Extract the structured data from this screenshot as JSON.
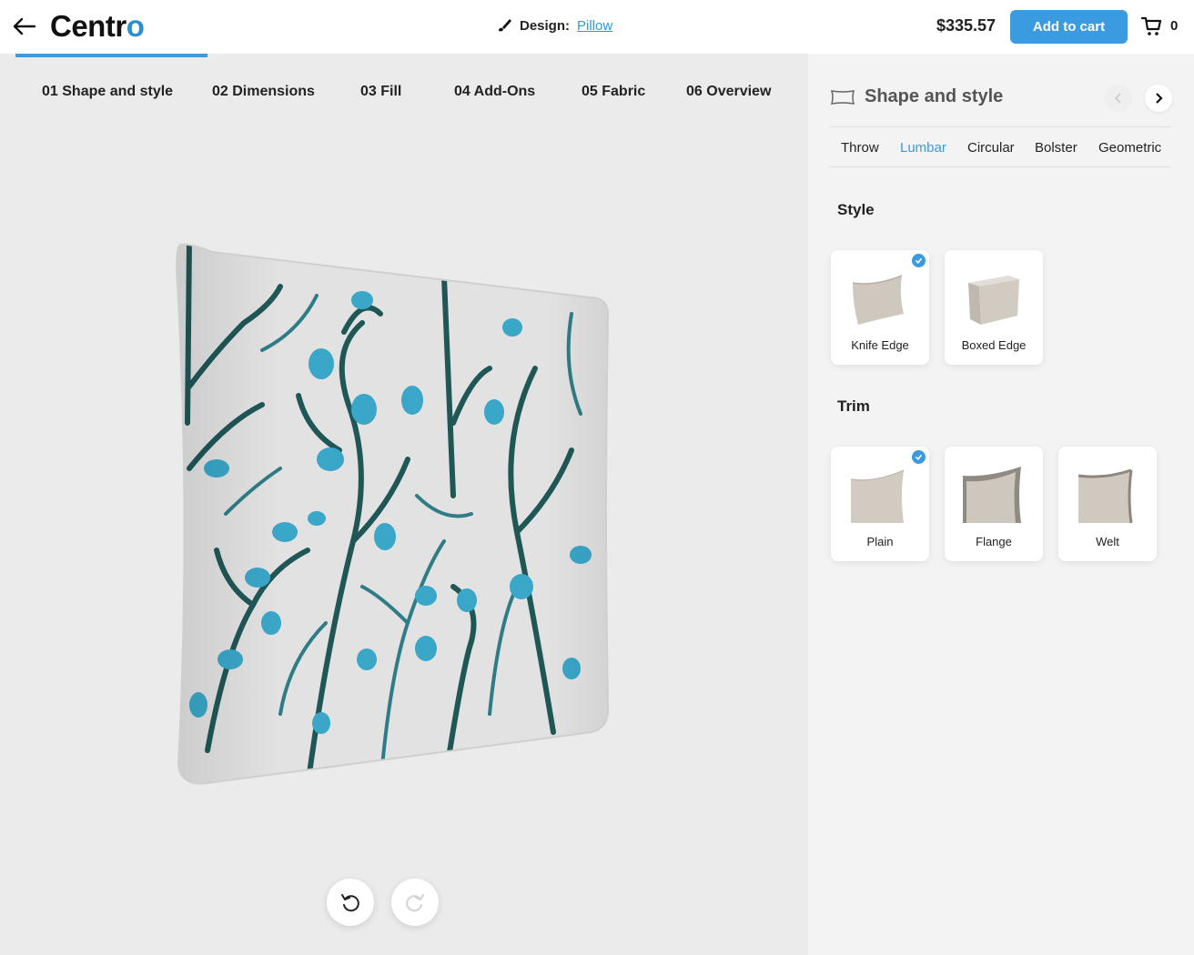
{
  "header": {
    "logo_prefix": "Centr",
    "logo_suffix": "o",
    "design_label": "Design:",
    "design_name": "Pillow",
    "price": "$335.57",
    "add_to_cart": "Add to cart",
    "cart_count": "0"
  },
  "steps": [
    {
      "label": "01 Shape and style"
    },
    {
      "label": "02 Dimensions"
    },
    {
      "label": "03 Fill"
    },
    {
      "label": "04 Add-Ons"
    },
    {
      "label": "05 Fabric"
    },
    {
      "label": "06 Overview"
    }
  ],
  "panel": {
    "title": "Shape and style",
    "shape_tabs": [
      {
        "label": "Throw",
        "active": false
      },
      {
        "label": "Lumbar",
        "active": true
      },
      {
        "label": "Circular",
        "active": false
      },
      {
        "label": "Bolster",
        "active": false
      },
      {
        "label": "Geometric",
        "active": false
      }
    ],
    "style": {
      "label": "Style",
      "options": [
        {
          "name": "Knife Edge",
          "selected": true
        },
        {
          "name": "Boxed Edge",
          "selected": false
        }
      ]
    },
    "trim": {
      "label": "Trim",
      "options": [
        {
          "name": "Plain",
          "selected": true
        },
        {
          "name": "Flange",
          "selected": false
        },
        {
          "name": "Welt",
          "selected": false
        }
      ]
    }
  },
  "colors": {
    "accent": "#3a9be0",
    "pattern_dark": "#1e5a5a",
    "pattern_light": "#3aa6c8"
  }
}
